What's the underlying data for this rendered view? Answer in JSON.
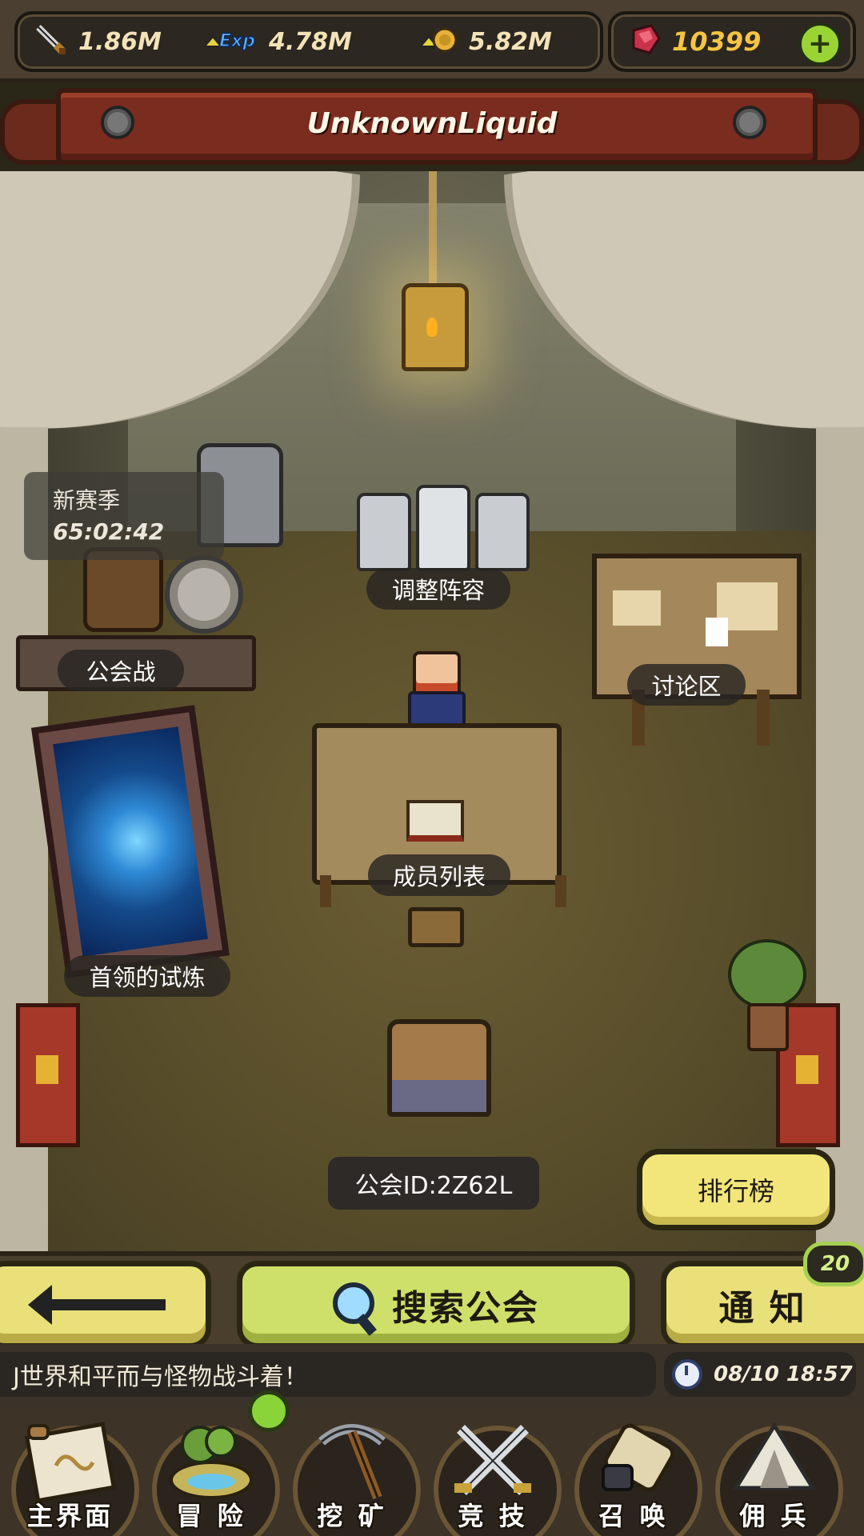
{
  "resources": {
    "attack": "1.86M",
    "exp": "4.78M",
    "gold": "5.82M",
    "gems": "10399"
  },
  "banner": {
    "title": "UnknownLiquid"
  },
  "season": {
    "title": "新赛季",
    "timer": "65:02:42"
  },
  "scene_labels": {
    "adjust_lineup": "调整阵容",
    "guild_war": "公会战",
    "discussion": "讨论区",
    "member_list": "成员列表",
    "boss_trial": "首领的试炼"
  },
  "guild_id": "公会ID:2Z62L",
  "ranking_button": "排行榜",
  "controls": {
    "search_label": "搜索公会",
    "notify_label": "通 知",
    "notify_badge": "20"
  },
  "ticker": {
    "message": "J世界和平而与怪物战斗着！",
    "datetime": "08/10 18:57"
  },
  "nav": [
    {
      "label": "主界面",
      "icon": "scroll-map-icon"
    },
    {
      "label": "冒 险",
      "icon": "island-icon"
    },
    {
      "label": "挖 矿",
      "icon": "pickaxe-icon"
    },
    {
      "label": "竞 技",
      "icon": "crossed-swords-icon"
    },
    {
      "label": "召 唤",
      "icon": "summon-scroll-icon"
    },
    {
      "label": "佣 兵",
      "icon": "tent-icon"
    }
  ],
  "colors": {
    "button_yellow": "#e9e07a",
    "search_green": "#cfe06a",
    "banner_red": "#7a2c1e",
    "gem_gold": "#f5c542"
  }
}
